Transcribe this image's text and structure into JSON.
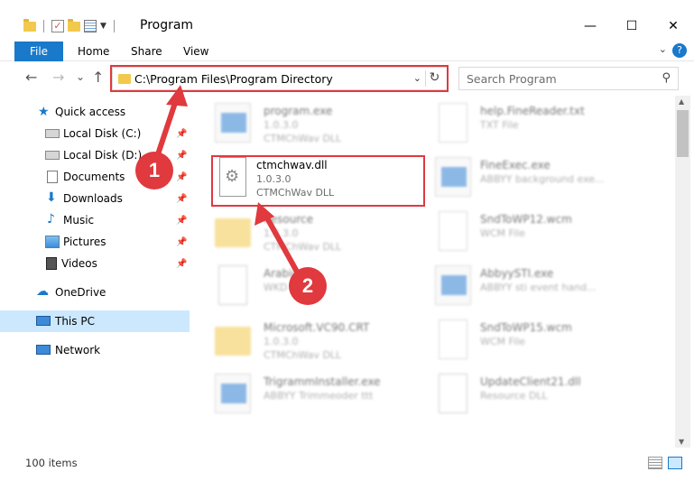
{
  "window": {
    "title": "Program",
    "minimize": "—",
    "maximize": "☐",
    "close": "✕"
  },
  "ribbon": {
    "tabs": [
      "File",
      "Home",
      "Share",
      "View"
    ],
    "help": "?"
  },
  "navigation": {
    "back": "←",
    "forward": "→",
    "recent": "⌄",
    "up": "↑",
    "address": "C:\\Program Files\\Program Directory",
    "search_placeholder": "Search Program"
  },
  "sidebar": {
    "items": [
      {
        "label": "Quick access",
        "icon": "star-icon"
      },
      {
        "label": "Local Disk (C:)",
        "icon": "disk-icon",
        "pinned": true
      },
      {
        "label": "Local Disk (D:)",
        "icon": "disk-icon",
        "pinned": true
      },
      {
        "label": "Documents",
        "icon": "documents-icon",
        "pinned": true
      },
      {
        "label": "Downloads",
        "icon": "downloads-icon",
        "pinned": true
      },
      {
        "label": "Music",
        "icon": "music-icon",
        "pinned": true
      },
      {
        "label": "Pictures",
        "icon": "pictures-icon",
        "pinned": true
      },
      {
        "label": "Videos",
        "icon": "videos-icon",
        "pinned": true
      },
      {
        "label": "OneDrive",
        "icon": "onedrive-icon"
      },
      {
        "label": "This PC",
        "icon": "pc-icon",
        "selected": true
      },
      {
        "label": "Network",
        "icon": "network-icon"
      }
    ]
  },
  "files": {
    "left": [
      {
        "name": "program.exe",
        "line2": "1.0.3.0",
        "line3": "CTMChWav DLL",
        "icon": "exe-icon"
      },
      {
        "name": "ctmchwav.dll",
        "line2": "1.0.3.0",
        "line3": "CTMChWav DLL",
        "icon": "dll-icon"
      },
      {
        "name": "Resource",
        "line2": "1.0.3.0",
        "line3": "CTMChWav DLL",
        "icon": "folder-icon"
      },
      {
        "name": "Arabic",
        "line2": "WKD File",
        "line3": "",
        "icon": "dll-icon"
      },
      {
        "name": "Microsoft.VC90.CRT",
        "line2": "1.0.3.0",
        "line3": "CTMChWav DLL",
        "icon": "folder-icon"
      },
      {
        "name": "TrigrammInstaller.exe",
        "line2": "ABBYY Trimmeoder ttt",
        "line3": "",
        "icon": "exe-icon"
      }
    ],
    "right": [
      {
        "name": "help.FineReader.txt",
        "line2": "TXT File",
        "icon": "txt-icon"
      },
      {
        "name": "FineExec.exe",
        "line2": "ABBYY background exe...",
        "icon": "exe-icon"
      },
      {
        "name": "SndToWP12.wcm",
        "line2": "WCM File",
        "icon": "txt-icon"
      },
      {
        "name": "AbbyySTI.exe",
        "line2": "ABBYY sti event hand...",
        "icon": "exe-icon"
      },
      {
        "name": "SndToWP15.wcm",
        "line2": "WCM File",
        "icon": "txt-icon"
      },
      {
        "name": "UpdateClient21.dll",
        "line2": "Resource DLL",
        "icon": "dll-icon"
      }
    ]
  },
  "status": {
    "count": "100 items"
  },
  "annotations": {
    "step1": "1",
    "step2": "2",
    "color": "#e0393e"
  }
}
